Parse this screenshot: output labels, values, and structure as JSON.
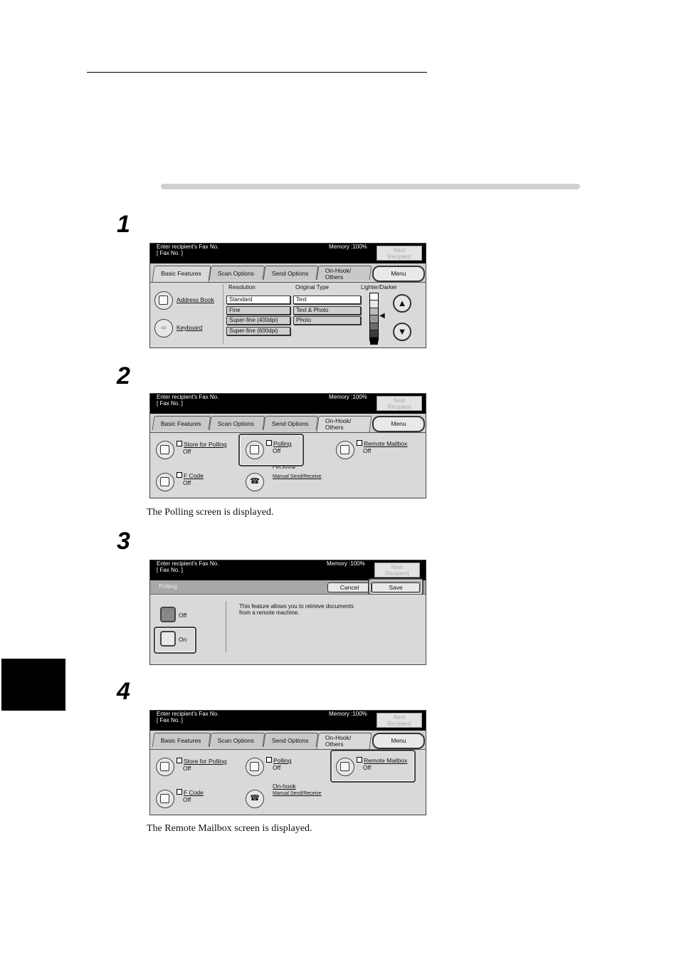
{
  "steps": [
    "1",
    "2",
    "3",
    "4"
  ],
  "captions": {
    "step2": "The Polling screen is displayed.",
    "step4": "The Remote Mailbox screen is displayed."
  },
  "common": {
    "prompt_line1": "Enter recipient's Fax No.",
    "prompt_line2": "[  Fax No. ]",
    "memory": "Memory :100%",
    "next_line1": "Next",
    "next_line2": "Recipient",
    "tab_basic": "Basic Features",
    "tab_scan": "Scan Options",
    "tab_send": "Send Options",
    "tab_onhook_1": "On-Hook/",
    "tab_onhook_2": "Others",
    "menu": "Menu"
  },
  "screen1": {
    "address_book": "Address Book",
    "keyboard": "Keyboard",
    "resolution_head": "Resolution",
    "resolution_options": [
      "Standard",
      "Fine",
      "Super-fine (400dpi)",
      "Super-fine (600dpi)"
    ],
    "original_head": "Original Type",
    "original_options": [
      "Text",
      "Text & Photo",
      "Photo"
    ],
    "lighter_head": "Lighter/Darker",
    "darkness_level": 4
  },
  "others": {
    "store_polling": "Store for Polling",
    "polling": "Polling",
    "remote_mailbox": "Remote Mailbox",
    "fcode": "F Code",
    "onhook": "On-hook",
    "onhook_sub": "Manual Send/Receive",
    "off": "Off"
  },
  "screen3": {
    "title": "Polling",
    "cancel": "Cancel",
    "save": "Save",
    "opt_off": "Off",
    "opt_on": "On",
    "desc_line1": "This feature allows you to retrieve documents",
    "desc_line2": "from a remote machine."
  }
}
